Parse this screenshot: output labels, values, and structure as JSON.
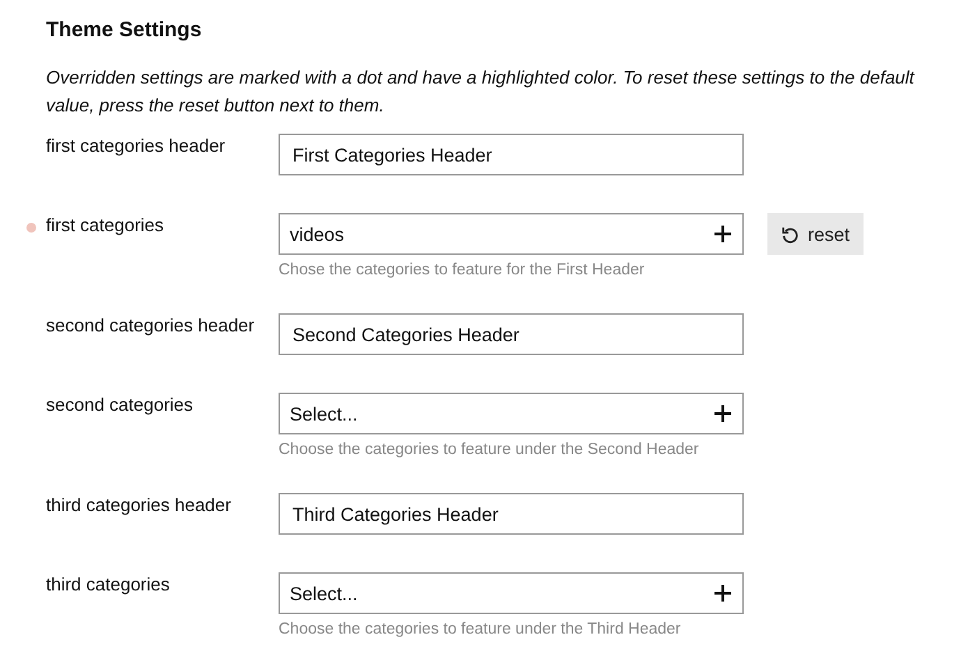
{
  "title": "Theme Settings",
  "intro": "Overridden settings are marked with a dot and have a highlighted color. To reset these settings to the default value, press the reset button next to them.",
  "settings": [
    {
      "label": "first categories header",
      "kind": "text",
      "overridden": false,
      "value": "First Categories Header"
    },
    {
      "label": "first categories",
      "kind": "select",
      "overridden": true,
      "value": "videos",
      "description": "Chose the categories to feature for the First Header",
      "reset_label": "reset"
    },
    {
      "label": "second categories header",
      "kind": "text",
      "overridden": false,
      "value": "Second Categories Header"
    },
    {
      "label": "second categories",
      "kind": "select",
      "overridden": false,
      "placeholder": "Select...",
      "description": "Choose the categories to feature under the Second Header"
    },
    {
      "label": "third categories header",
      "kind": "text",
      "overridden": false,
      "value": "Third Categories Header"
    },
    {
      "label": "third categories",
      "kind": "select",
      "overridden": false,
      "placeholder": "Select...",
      "description": "Choose the categories to feature under the Third Header"
    }
  ]
}
